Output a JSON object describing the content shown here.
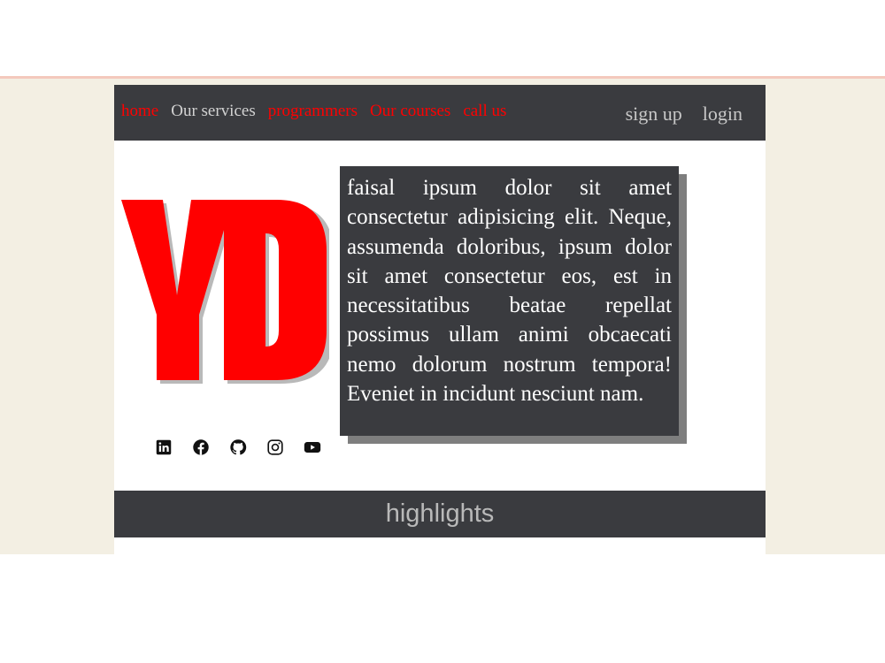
{
  "nav": {
    "items": [
      {
        "label": "home",
        "color": "#ff0000"
      },
      {
        "label": "Our services",
        "color": "#d3d3d3"
      },
      {
        "label": "programmers",
        "color": "#ff0000"
      },
      {
        "label": "Our courses",
        "color": "#ff0000"
      },
      {
        "label": "call us",
        "color": "#ff0000"
      }
    ],
    "auth": {
      "signup": "sign up",
      "login": "login"
    }
  },
  "logo": {
    "text": "YD",
    "color": "#ff0000"
  },
  "intro": {
    "text": "faisal ipsum dolor sit amet consectetur adipisicing elit. Neque, assumenda doloribus, ipsum dolor sit amet consectetur eos, est in necessitatibus beatae repellat possimus ullam animi obcaecati nemo dolorum nostrum tempora! Eveniet in incidunt nesciunt nam."
  },
  "socials": [
    "linkedin-icon",
    "facebook-icon",
    "github-icon",
    "instagram-icon",
    "youtube-icon"
  ],
  "section": {
    "title": "highlights"
  },
  "colors": {
    "dark": "#3a3b3f",
    "accent": "#ff0000",
    "background": "#f3efe3"
  }
}
